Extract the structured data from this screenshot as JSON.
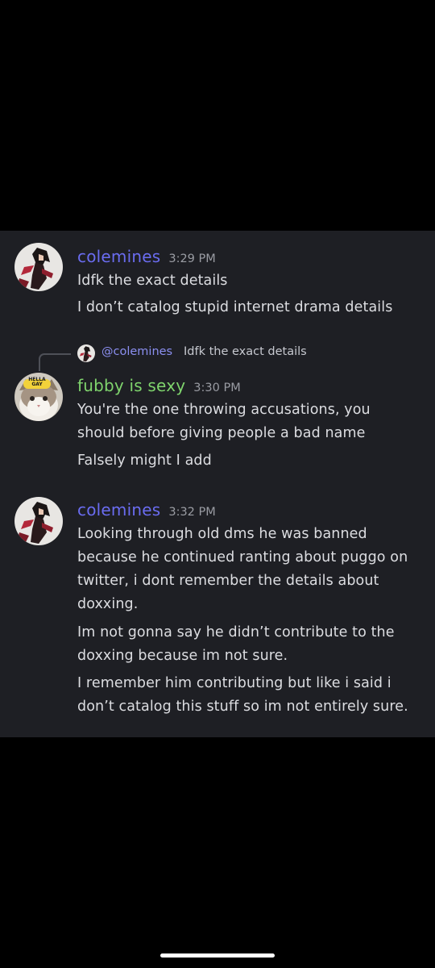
{
  "colors": {
    "background": "#000000",
    "chat_background": "#1e1f24",
    "colemines_name": "#6a6cf0",
    "fubby_name": "#7fd46d",
    "timestamp": "#9a9ca3",
    "text": "#dcdde1",
    "mention": "#8b8ff0"
  },
  "messages": [
    {
      "username": "colemines",
      "timestamp": "3:29 PM",
      "avatar_icon": "anime-character-avatar-icon",
      "lines": [
        "Idfk the exact details",
        "I don’t catalog stupid internet drama details"
      ]
    },
    {
      "reply_to": {
        "mention": "@colemines",
        "text": "Idfk the exact details"
      },
      "username": "fubby is sexy",
      "timestamp": "3:30 PM",
      "avatar_icon": "cat-hella-gay-avatar-icon",
      "avatar_badge": "HELLA GAY",
      "lines": [
        "You're the one throwing accusations, you",
        "should before giving people a bad name",
        "Falsely might I add"
      ]
    },
    {
      "username": "colemines",
      "timestamp": "3:32 PM",
      "avatar_icon": "anime-character-avatar-icon",
      "lines": [
        "Looking through old dms he was banned",
        "because he continued ranting about puggo on",
        "twitter, i dont remember the details about",
        "doxxing.",
        "Im not gonna say he didn’t contribute to the",
        "doxxing because im not sure.",
        "I remember him contributing but like i said i",
        "don’t catalog this stuff so im not entirely sure."
      ]
    }
  ]
}
